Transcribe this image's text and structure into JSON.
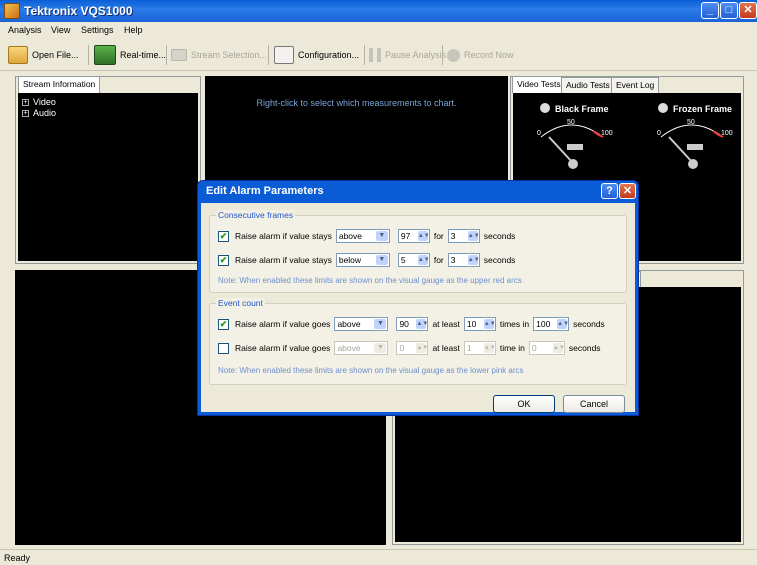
{
  "window": {
    "title": "Tektronix VQS1000"
  },
  "menu": [
    "Analysis",
    "View",
    "Settings",
    "Help"
  ],
  "toolbar": {
    "open_file": "Open File...",
    "realtime": "Real-time...",
    "stream_selection": "Stream Selection...",
    "configuration": "Configuration...",
    "pause_analysis": "Pause Analysis",
    "record_now": "Record Now"
  },
  "stream_panel": {
    "tab": "Stream Information",
    "items": [
      "Video",
      "Audio"
    ]
  },
  "chart_panel": {
    "hint": "Right-click to select which measurements to chart."
  },
  "gauge_panel": {
    "tabs": [
      "Video Tests",
      "Audio Tests",
      "Event Log"
    ],
    "gauges": [
      {
        "label": "Black Frame",
        "min": "0",
        "mid": "50",
        "max": "100"
      },
      {
        "label": "Frozen Frame",
        "min": "0",
        "mid": "50",
        "max": "100"
      }
    ]
  },
  "bottom_right": {
    "tab_fragment": "s"
  },
  "status": {
    "text": "Ready"
  },
  "dialog": {
    "title": "Edit Alarm Parameters",
    "help": "?",
    "close": "✕",
    "consecutive": {
      "label": "Consecutive frames",
      "rows": [
        {
          "checked": "✔",
          "text": "Raise alarm if value stays",
          "cond": "above",
          "value": "97",
          "for": "for",
          "count": "3",
          "unit": "seconds"
        },
        {
          "checked": "✔",
          "text": "Raise alarm if value stays",
          "cond": "below",
          "value": "5",
          "for": "for",
          "count": "3",
          "unit": "seconds"
        }
      ],
      "note": "Note: When enabled these limits are shown on the visual gauge as the upper red arcs"
    },
    "event": {
      "label": "Event count",
      "rows": [
        {
          "checked": "✔",
          "text": "Raise alarm if value goes",
          "cond": "above",
          "value": "90",
          "atleast": "at least",
          "times": "10",
          "times_label": "times in",
          "secs": "100",
          "unit": "seconds"
        },
        {
          "checked": "",
          "text": "Raise alarm if value goes",
          "cond": "above",
          "value": "0",
          "atleast": "at least",
          "times": "1",
          "times_label": "time  in",
          "secs": "0",
          "unit": "seconds"
        }
      ],
      "note": "Note: When enabled these limits are shown on the visual gauge as the lower pink arcs"
    },
    "ok": "OK",
    "cancel": "Cancel"
  }
}
